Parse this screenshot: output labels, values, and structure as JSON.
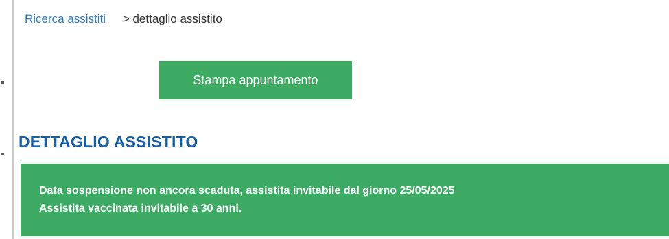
{
  "breadcrumb": {
    "link_label": "Ricerca assistiti",
    "current_label": "> dettaglio assistito"
  },
  "actions": {
    "print_appointment_label": "Stampa appuntamento"
  },
  "section": {
    "title": "DETTAGLIO ASSISTITO"
  },
  "alert": {
    "lines": [
      "Data sospensione non ancora scaduta, assistita invitabile dal giorno 25/05/2025",
      "Assistita vaccinata invitabile a 30 anni."
    ]
  },
  "colors": {
    "link": "#2c7bbf",
    "title": "#155ea9",
    "success_green": "#3dab62",
    "text_white": "#ffffff"
  }
}
